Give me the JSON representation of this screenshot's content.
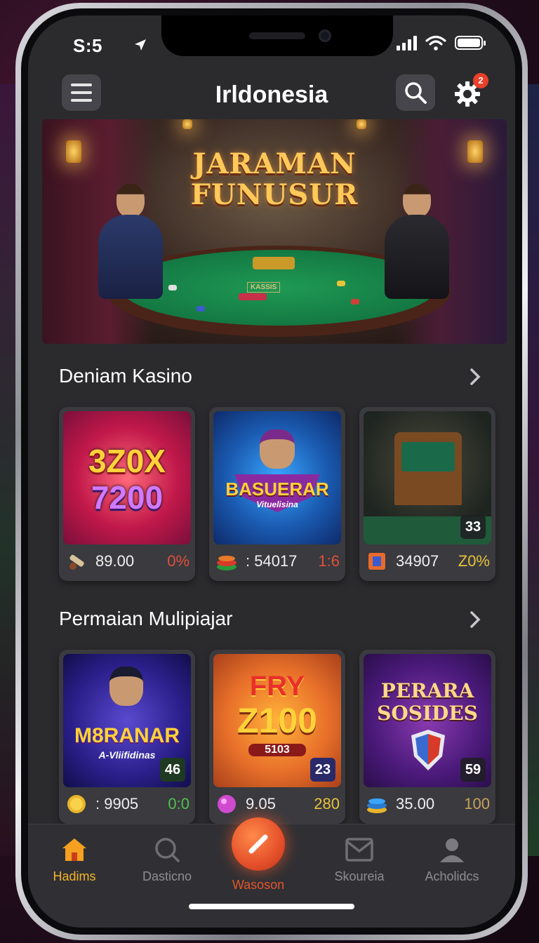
{
  "status_bar": {
    "time": "S:5"
  },
  "header": {
    "title": "Irldonesia",
    "notification_count": "2"
  },
  "banner": {
    "title_line1": "JARAMAN",
    "title_line2": "FUNUSUR",
    "table_label": "KASSIS"
  },
  "sections": [
    {
      "title": "Deniam Kasino",
      "cards": [
        {
          "thumb_line1": "3Z0X",
          "thumb_line2": "7200",
          "icon": "cannon-icon",
          "value": "89.00",
          "stat": "0%",
          "stat_color": "#e0503a"
        },
        {
          "thumb_line1": "BASUERAR",
          "thumb_line2": "Vituelisina",
          "icon": "chips-stack-icon",
          "value": ": 54017",
          "stat": "1:6",
          "stat_color": "#e0503a"
        },
        {
          "thumb_badge": "33",
          "icon": "card-icon",
          "value": "34907",
          "stat": "Z0%",
          "stat_color": "#e8c23a"
        }
      ]
    },
    {
      "title": "Permaian Mulipiajar",
      "cards": [
        {
          "thumb_line1": "M8RANAR",
          "thumb_line2": "A-Vliifidinas",
          "thumb_badge": "46",
          "icon": "gold-coin-icon",
          "value": ": 9905",
          "stat": "0:0",
          "stat_color": "#4fc24a"
        },
        {
          "thumb_line1": "FRY",
          "thumb_line2": "Z100",
          "thumb_line3": "5103",
          "thumb_badge": "23",
          "icon": "gem-icon",
          "value": "9.05",
          "stat": "280",
          "stat_color": "#e8c23a"
        },
        {
          "thumb_line1": "PERARA",
          "thumb_line2": "SOSIDES",
          "thumb_badge": "59",
          "icon": "blue-coins-icon",
          "value": "35.00",
          "stat": "100",
          "stat_color": "#c8a25a"
        }
      ]
    }
  ],
  "bottom_nav": [
    {
      "label": "Hadims",
      "icon": "home-icon",
      "active": true
    },
    {
      "label": "Dasticno",
      "icon": "search-icon",
      "active": false
    },
    {
      "label": "Wasoson",
      "icon": "slash-icon",
      "active": false
    },
    {
      "label": "Skoureia",
      "icon": "inbox-icon",
      "active": false
    },
    {
      "label": "Acholidcs",
      "icon": "user-icon",
      "active": false
    }
  ],
  "colors": {
    "accent": "#f5b327",
    "fab": "#e5502a",
    "card_bg": "#3a3a3f",
    "screen_bg": "#2b2b2e"
  }
}
